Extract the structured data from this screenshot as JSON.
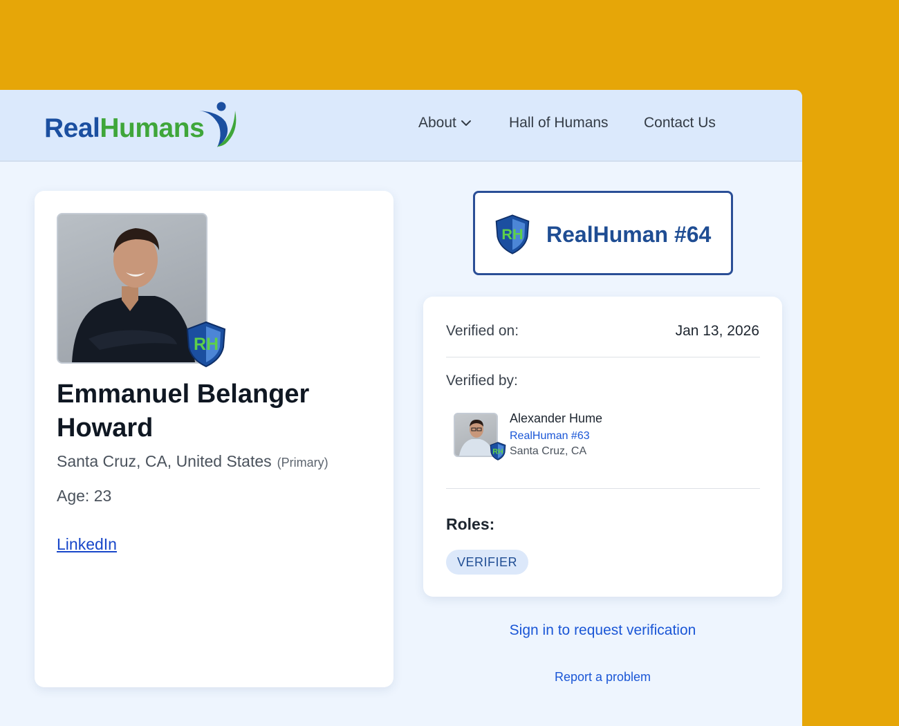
{
  "brand": {
    "logo_part1": "Real",
    "logo_part2": "Humans",
    "blue": "#1B4FA0",
    "green": "#3FA63A"
  },
  "nav": {
    "about": "About",
    "hall": "Hall of Humans",
    "contact": "Contact Us"
  },
  "profile": {
    "name": "Emmanuel Belanger Howard",
    "location": "Santa Cruz, CA, United States",
    "primary": "(Primary)",
    "age": "Age: 23",
    "linkedin": "LinkedIn",
    "badge_text": "RH"
  },
  "id_badge": {
    "label": "RealHuman #64",
    "badge_text": "RH"
  },
  "verification": {
    "verified_on_label": "Verified on:",
    "verified_on_value": "Jan 13, 2026",
    "verified_by_label": "Verified by:",
    "verifier": {
      "name": "Alexander Hume",
      "id": "RealHuman #63",
      "location": "Santa Cruz, CA",
      "badge_text": "RH"
    },
    "roles_label": "Roles:",
    "roles": [
      "VERIFIER"
    ]
  },
  "links": {
    "signin": "Sign in to request verification",
    "report": "Report a problem"
  },
  "colors": {
    "page_bg": "#E6A608",
    "window_bg": "#EEF5FE",
    "navbar_bg": "#DBE9FC",
    "link": "#1A56D6"
  }
}
